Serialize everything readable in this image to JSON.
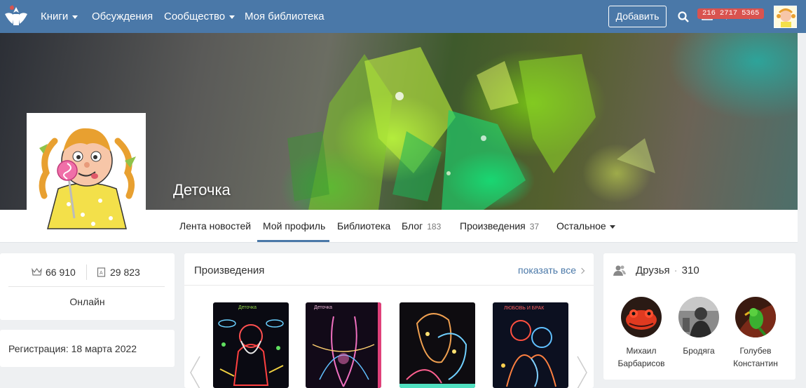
{
  "nav": {
    "books": "Книги",
    "discussions": "Обсуждения",
    "community": "Сообщество",
    "my_library": "Моя библиотека",
    "add_button": "Добавить",
    "badges": [
      "216",
      "2717",
      "5365"
    ],
    "accent": "#4a78a8"
  },
  "profile": {
    "name": "Деточка"
  },
  "tabs": [
    {
      "label": "Лента новостей",
      "count": ""
    },
    {
      "label": "Мой профиль",
      "count": ""
    },
    {
      "label": "Библиотека",
      "count": ""
    },
    {
      "label": "Блог",
      "count": "183"
    },
    {
      "label": "Произведения",
      "count": "37"
    },
    {
      "label": "Остальное",
      "count": ""
    }
  ],
  "stats": {
    "rating": "66 910",
    "books": "29 823",
    "status": "Онлайн"
  },
  "registration": "Регистрация: 18 марта 2022",
  "works": {
    "title": "Произведения",
    "show_all": "показать все",
    "covers": [
      {
        "caption": "Деточка"
      },
      {
        "caption": "Деточка"
      },
      {
        "caption": ""
      },
      {
        "caption": "ЛЮБОВЬ И БРАК"
      }
    ]
  },
  "friends": {
    "title": "Друзья",
    "count": "310",
    "items": [
      {
        "name": "Михаил Барбарисов"
      },
      {
        "name": "Бродяга"
      },
      {
        "name": "Голубев Константин"
      }
    ]
  }
}
